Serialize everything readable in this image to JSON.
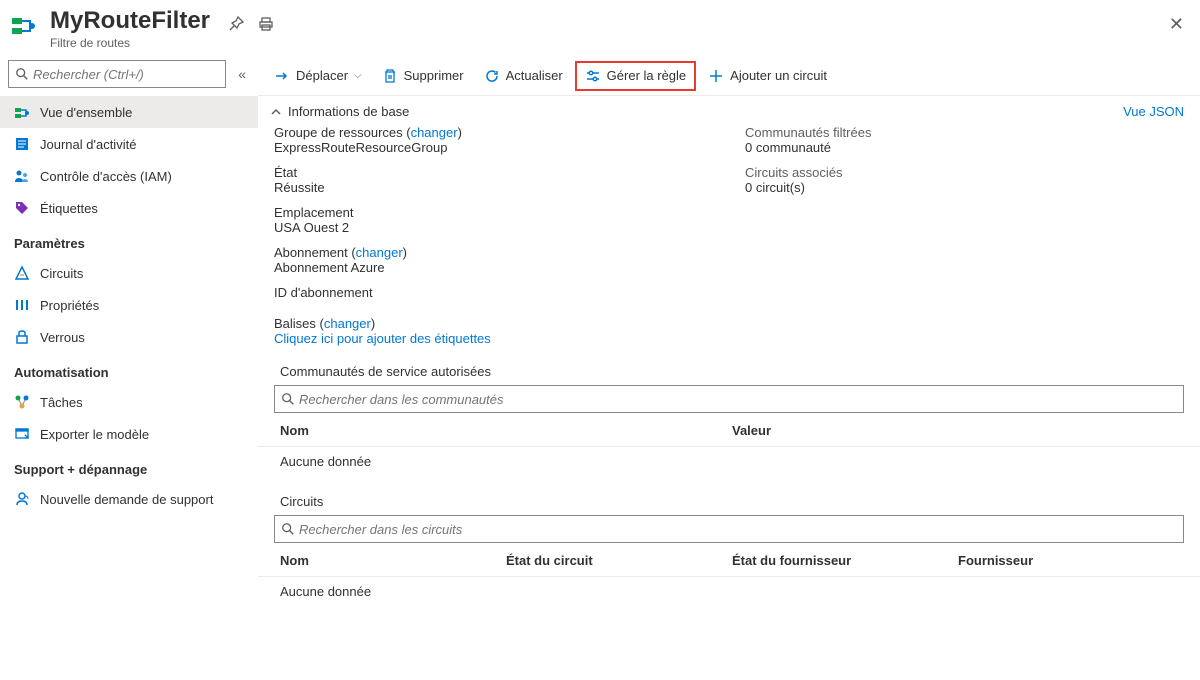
{
  "header": {
    "title": "MyRouteFilter",
    "subtitle": "Filtre de routes"
  },
  "sidebar": {
    "search_placeholder": "Rechercher (Ctrl+/)",
    "items_main": [
      {
        "label": "Vue d'ensemble"
      },
      {
        "label": "Journal d'activité"
      },
      {
        "label": "Contrôle d'accès (IAM)"
      },
      {
        "label": "Étiquettes"
      }
    ],
    "group_settings": "Paramètres",
    "items_settings": [
      {
        "label": "Circuits"
      },
      {
        "label": "Propriétés"
      },
      {
        "label": "Verrous"
      }
    ],
    "group_auto": "Automatisation",
    "items_auto": [
      {
        "label": "Tâches"
      },
      {
        "label": "Exporter le modèle"
      }
    ],
    "group_support": "Support + dépannage",
    "items_support": [
      {
        "label": "Nouvelle demande de support"
      }
    ]
  },
  "toolbar": {
    "move": "Déplacer",
    "delete": "Supprimer",
    "refresh": "Actualiser",
    "manage_rule": "Gérer la règle",
    "add_circuit": "Ajouter un circuit"
  },
  "essentials": {
    "header": "Informations de base",
    "view_json": "Vue JSON",
    "rg_label": "Groupe de ressources (",
    "rg_change": "changer",
    "close_paren": ")",
    "rg_value": "ExpressRouteResourceGroup",
    "state_label": "État",
    "state_value": "Réussite",
    "loc_label": "Emplacement",
    "loc_value": "USA Ouest 2",
    "sub_label": "Abonnement (",
    "sub_change": "changer",
    "sub_value": "Abonnement Azure",
    "subid_label": "ID d'abonnement",
    "comm_label": "Communautés filtrées",
    "comm_value": "0 communauté",
    "circ_label": "Circuits associés",
    "circ_value": "0 circuit(s)",
    "tags_label": "Balises (",
    "tags_change": "changer",
    "tags_link": "Cliquez ici pour ajouter des étiquettes"
  },
  "communities": {
    "title": "Communautés de service autorisées",
    "search_placeholder": "Rechercher dans les communautés",
    "col_name": "Nom",
    "col_value": "Valeur",
    "no_data": "Aucune donnée"
  },
  "circuits": {
    "title": "Circuits",
    "search_placeholder": "Rechercher dans les circuits",
    "col_name": "Nom",
    "col_state": "État du circuit",
    "col_provider_state": "État du fournisseur",
    "col_provider": "Fournisseur",
    "no_data": "Aucune donnée"
  }
}
